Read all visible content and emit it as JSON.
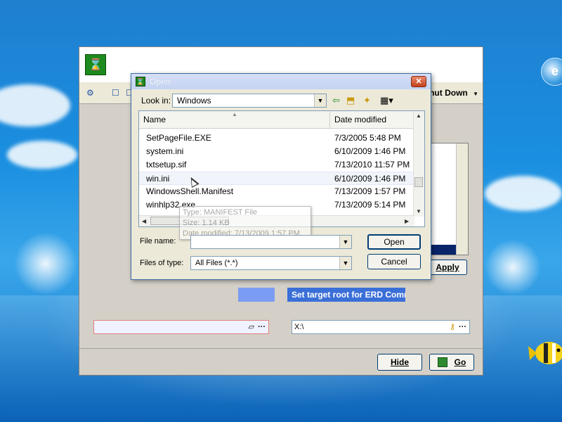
{
  "app": {
    "logo_glyph": "⌛",
    "shutdown_label": "hut Down",
    "shutdown_arrow": "▼",
    "apply_label": "Apply",
    "target_root_label": "Set target root for ERD Comm",
    "left_field_value": "",
    "right_field_value": "X:\\",
    "dots": "···",
    "hide_label": "Hide",
    "go_label": "Go"
  },
  "dialog": {
    "title": "Open",
    "close_glyph": "✕",
    "look_in_label": "Look in:",
    "look_in_value": "Windows",
    "columns": {
      "name": "Name",
      "date_modified": "Date modified"
    },
    "files": [
      {
        "name": "SetPageFile.EXE",
        "date": "7/3/2005 5:48 PM"
      },
      {
        "name": "system.ini",
        "date": "6/10/2009 1:46 PM"
      },
      {
        "name": "txtsetup.sif",
        "date": "7/13/2010 11:57 PM"
      },
      {
        "name": "win.ini",
        "date": "6/10/2009 1:46 PM"
      },
      {
        "name": "WindowsShell.Manifest",
        "date": "7/13/2009 1:57 PM"
      },
      {
        "name": "winhlp32.exe",
        "date": "7/13/2009 5:14 PM"
      }
    ],
    "tooltip": {
      "type": "Type: MANIFEST File",
      "size": "Size: 1.14 KB",
      "date": "Date modified: 7/13/2009 1:57 PM"
    },
    "file_name_label": "File name:",
    "file_name_value": "",
    "files_of_type_label": "Files of type:",
    "files_of_type_value": "All Files (*.*)",
    "open_label": "Open",
    "cancel_label": "Cancel"
  },
  "colors": {
    "accent": "#3b6fd8",
    "selection": "#0a246a",
    "title_bar": "#c4d3f2"
  }
}
